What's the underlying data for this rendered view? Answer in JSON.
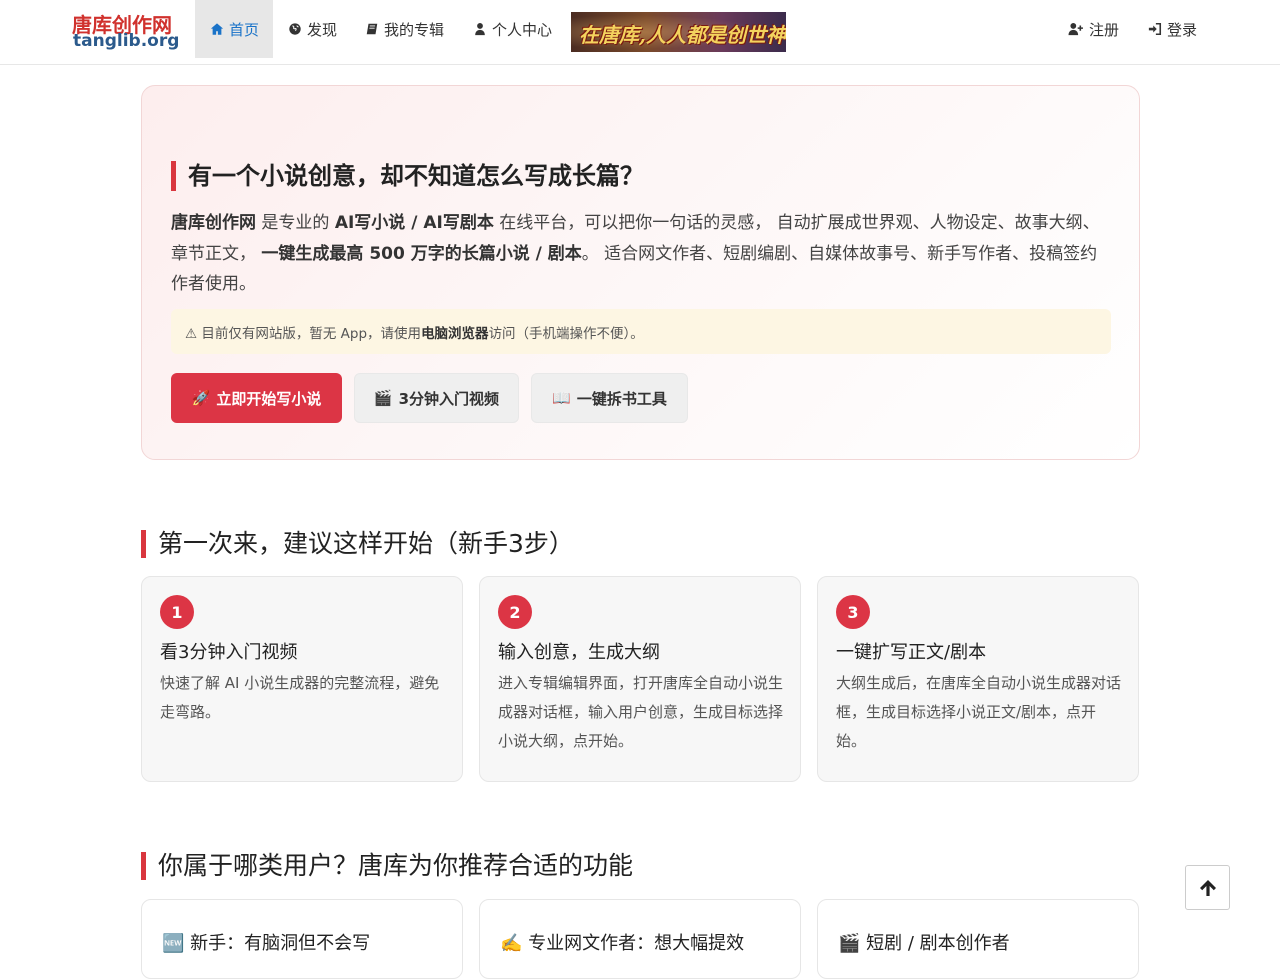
{
  "navbar": {
    "logo_cn": "唐库创作网",
    "logo_en": "tanglib.org",
    "items": [
      {
        "label": "首页",
        "icon": "home-icon"
      },
      {
        "label": "发现",
        "icon": "globe-icon"
      },
      {
        "label": "我的专辑",
        "icon": "book-icon"
      },
      {
        "label": "个人中心",
        "icon": "user-icon"
      }
    ],
    "banner_text": "在唐库,人人都是创世神!",
    "register_label": "注册",
    "login_label": "登录"
  },
  "hero": {
    "title": "有一个小说创意，却不知道怎么写成长篇？",
    "desc_brand": "唐库创作网",
    "desc_1": " 是专业的 ",
    "desc_bold_1": "AI写小说 / AI写剧本",
    "desc_2": " 在线平台，可以把你一句话的灵感， 自动扩展成世界观、人物设定、故事大纲、章节正文， ",
    "desc_bold_2": "一键生成最高 500 万字的长篇小说 / 剧本",
    "desc_3": "。 适合网文作者、短剧编剧、自媒体故事号、新手写作者、投稿签约作者使用。",
    "notice_1": "⚠ 目前仅有网站版，暂无 App，请使用 ",
    "notice_bold": "电脑浏览器",
    "notice_2": " 访问（手机端操作不便）。",
    "buttons": [
      {
        "emoji": "🚀",
        "label": "立即开始写小说"
      },
      {
        "emoji": "🎬",
        "label": "3分钟入门视频"
      },
      {
        "emoji": "📖",
        "label": "一键拆书工具"
      }
    ]
  },
  "steps_section": {
    "title": "第一次来，建议这样开始（新手3步）",
    "steps": [
      {
        "num": "1",
        "title": "看3分钟入门视频",
        "desc": "快速了解 AI 小说生成器的完整流程，避免走弯路。"
      },
      {
        "num": "2",
        "title": "输入创意，生成大纲",
        "desc": "进入专辑编辑界面，打开唐库全自动小说生成器对话框，输入用户创意，生成目标选择小说大纲，点开始。"
      },
      {
        "num": "3",
        "title": "一键扩写正文/剧本",
        "desc": "大纲生成后，在唐库全自动小说生成器对话框，生成目标选择小说正文/剧本，点开始。"
      }
    ]
  },
  "users_section": {
    "title": "你属于哪类用户？唐库为你推荐合适的功能",
    "cards": [
      {
        "label": "🆕 新手：有脑洞但不会写"
      },
      {
        "label": "✍️ 专业网文作者：想大幅提效"
      },
      {
        "label": "🎬 短剧 / 剧本创作者"
      }
    ]
  }
}
